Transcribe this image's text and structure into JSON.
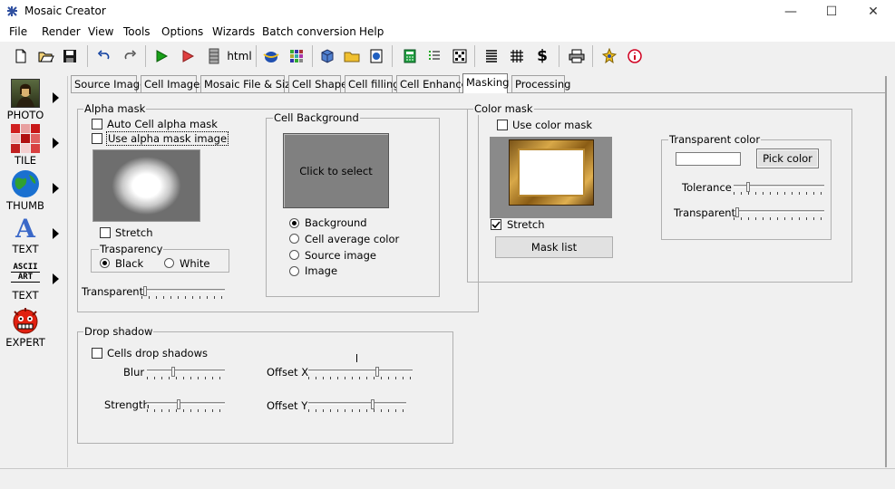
{
  "window": {
    "title": "Mosaic Creator",
    "minimize": "—",
    "maximize": "☐",
    "close": "✕"
  },
  "menu": [
    "File",
    "Render",
    "View",
    "Tools",
    "Options",
    "Wizards",
    "Batch conversion",
    "Help"
  ],
  "toolbar": {
    "html_label": "html"
  },
  "sidebar": [
    {
      "label": "PHOTO",
      "icon": "photo-icon"
    },
    {
      "label": "TILE",
      "icon": "tile-icon"
    },
    {
      "label": "THUMB",
      "icon": "globe-icon"
    },
    {
      "label": "TEXT",
      "icon": "text-a-icon"
    },
    {
      "label": "TEXT",
      "icon": "ascii-art-icon",
      "icon_text": [
        "ASCII",
        "ART"
      ]
    },
    {
      "label": "EXPERT",
      "icon": "expert-face-icon"
    }
  ],
  "tabs": [
    "Source Image",
    "Cell Images",
    "Mosaic File & Size",
    "Cell Shape",
    "Cell filling",
    "Cell Enhance",
    "Masking",
    "Processing"
  ],
  "active_tab": "Masking",
  "alpha_mask": {
    "title": "Alpha mask",
    "auto_cell_alpha": {
      "label": "Auto Cell alpha mask",
      "checked": false
    },
    "use_alpha_image": {
      "label": "Use alpha mask image",
      "checked": false
    },
    "stretch": {
      "label": "Stretch",
      "checked": false
    },
    "transparency": {
      "title": "Trasparency",
      "options": [
        "Black",
        "White"
      ],
      "selected": "Black"
    },
    "transparent_label": "Transparent"
  },
  "cell_background": {
    "title": "Cell Background",
    "preview_text": "Click to select",
    "options": [
      "Background",
      "Cell average color",
      "Source image",
      "Image"
    ],
    "selected": "Background"
  },
  "color_mask": {
    "title": "Color mask",
    "use_color_mask": {
      "label": "Use color mask",
      "checked": false
    },
    "stretch": {
      "label": "Stretch",
      "checked": true
    },
    "mask_list_button": "Mask list",
    "transparent_color": {
      "title": "Transparent color",
      "pick_button": "Pick color",
      "tolerance_label": "Tolerance",
      "transparent_label": "Transparent"
    }
  },
  "drop_shadow": {
    "title": "Drop shadow",
    "cells_drop_shadows": {
      "label": "Cells drop shadows",
      "checked": false
    },
    "blur_label": "Blur",
    "strength_label": "Strength",
    "offset_x_label": "Offset X",
    "offset_y_label": "Offset Y"
  },
  "colors": {
    "preview_bg": "#808080",
    "titlebar": "#ffffff",
    "window_bg": "#f0f0f0"
  }
}
